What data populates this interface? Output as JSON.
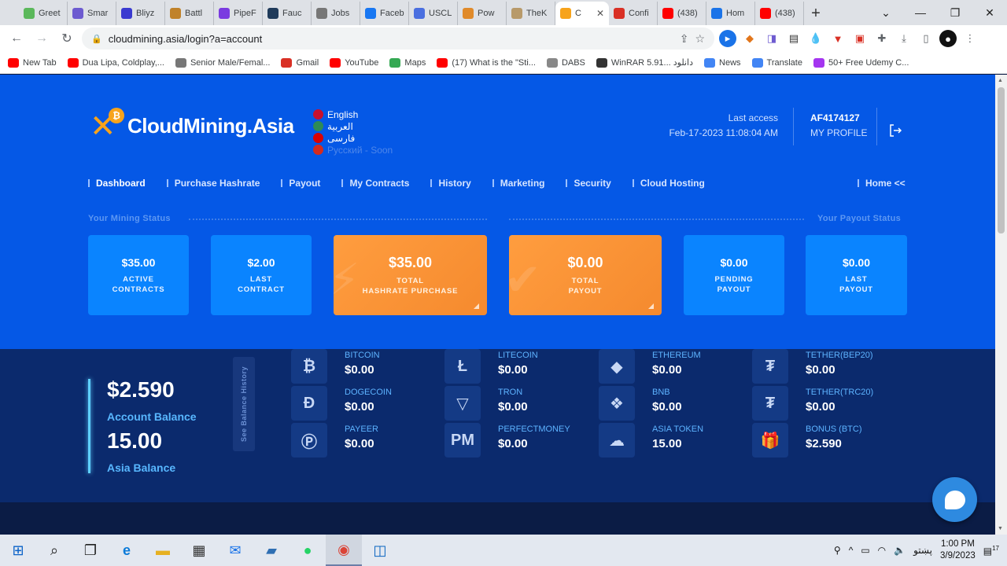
{
  "browser": {
    "tabs": [
      {
        "title": "Greet",
        "icon": "v-icon",
        "color": "#5bb85b"
      },
      {
        "title": "Smar",
        "icon": "shield-icon",
        "color": "#6d5bd0"
      },
      {
        "title": "Bliyz",
        "icon": "grid-icon",
        "color": "#3a3ad0"
      },
      {
        "title": "Battl",
        "icon": "cross-swords-icon",
        "color": "#c0822a"
      },
      {
        "title": "PipeF",
        "icon": "pipe-icon",
        "color": "#7a3be0"
      },
      {
        "title": "Fauc",
        "icon": "f-icon",
        "color": "#1f3a5a"
      },
      {
        "title": "Jobs",
        "icon": "person-icon",
        "color": "#777777"
      },
      {
        "title": "Faceb",
        "icon": "facebook-icon",
        "color": "#1877f2"
      },
      {
        "title": "USCL",
        "icon": "shield-icon",
        "color": "#4a6fe0"
      },
      {
        "title": "Pow",
        "icon": "paw-icon",
        "color": "#e08a2a"
      },
      {
        "title": "TheK",
        "icon": "badge-icon",
        "color": "#b89a6a"
      },
      {
        "title": "C",
        "icon": "cloudmining-icon",
        "color": "#f7a31b",
        "active": true
      },
      {
        "title": "Confi",
        "icon": "gmail-icon",
        "color": "#d93025"
      },
      {
        "title": "(438)",
        "icon": "youtube-icon",
        "color": "#ff0000"
      },
      {
        "title": "Hom",
        "icon": "chain-icon",
        "color": "#1a73e8"
      },
      {
        "title": "(438)",
        "icon": "youtube-icon",
        "color": "#ff0000"
      }
    ],
    "url": "cloudmining.asia/login?a=account",
    "bookmarks": [
      {
        "label": "New Tab",
        "color": "#ff0000"
      },
      {
        "label": "Dua Lipa, Coldplay,...",
        "color": "#ff0000"
      },
      {
        "label": "Senior Male/Femal...",
        "color": "#777777"
      },
      {
        "label": "Gmail",
        "color": "#d93025"
      },
      {
        "label": "YouTube",
        "color": "#ff0000"
      },
      {
        "label": "Maps",
        "color": "#34a853"
      },
      {
        "label": "(17) What is the \"Sti...",
        "color": "#ff0000"
      },
      {
        "label": "DABS",
        "color": "#888888"
      },
      {
        "label": "WinRAR 5.91... دانلود",
        "color": "#333333"
      },
      {
        "label": "News",
        "color": "#4285f4"
      },
      {
        "label": "Translate",
        "color": "#4285f4"
      },
      {
        "label": "50+ Free Udemy C...",
        "color": "#a435f0"
      }
    ]
  },
  "site": {
    "logo_text": "CloudMining.Asia",
    "languages": [
      {
        "label": "English",
        "flag": "#c8102e"
      },
      {
        "label": "العربية",
        "flag": "#2e8b57"
      },
      {
        "label": "فارسی",
        "flag": "#da0000"
      },
      {
        "label": "Русский - Soon",
        "flag": "#d52b1e",
        "muted": true
      }
    ],
    "last_access_label": "Last access",
    "last_access_time": "Feb-17-2023 11:08:04 AM",
    "account_id": "AF4174127",
    "my_profile": "MY PROFILE",
    "nav": [
      "Dashboard",
      "Purchase Hashrate",
      "Payout",
      "My Contracts",
      "History",
      "Marketing",
      "Security",
      "Cloud Hosting"
    ],
    "home_link": "Home <<",
    "mining_status_label": "Your Mining Status",
    "payout_status_label": "Your Payout Status",
    "cards": [
      {
        "value": "$35.00",
        "label1": "ACTIVE",
        "label2": "CONTRACTS"
      },
      {
        "value": "$2.00",
        "label1": "LAST",
        "label2": "CONTRACT"
      },
      {
        "value": "$35.00",
        "label1": "TOTAL",
        "label2": "HASHRATE PURCHASE"
      },
      {
        "value": "$0.00",
        "label1": "TOTAL",
        "label2": "PAYOUT"
      },
      {
        "value": "$0.00",
        "label1": "PENDING",
        "label2": "PAYOUT"
      },
      {
        "value": "$0.00",
        "label1": "LAST",
        "label2": "PAYOUT"
      }
    ],
    "account_balance": "$2.590",
    "account_balance_label": "Account Balance",
    "asia_balance": "15.00",
    "asia_balance_label": "Asia Balance",
    "balance_history": "See Balance History",
    "coins": [
      {
        "name": "BITCOIN",
        "value": "$0.00",
        "icon": "bitcoin-icon",
        "glyph": "₿"
      },
      {
        "name": "LITECOIN",
        "value": "$0.00",
        "icon": "litecoin-icon",
        "glyph": "Ł"
      },
      {
        "name": "ETHEREUM",
        "value": "$0.00",
        "icon": "ethereum-icon",
        "glyph": "◆"
      },
      {
        "name": "TETHER(BEP20)",
        "value": "$0.00",
        "icon": "tether-icon",
        "glyph": "₮"
      },
      {
        "name": "DOGECOIN",
        "value": "$0.00",
        "icon": "dogecoin-icon",
        "glyph": "Đ"
      },
      {
        "name": "TRON",
        "value": "$0.00",
        "icon": "tron-icon",
        "glyph": "▽"
      },
      {
        "name": "BNB",
        "value": "$0.00",
        "icon": "bnb-icon",
        "glyph": "❖"
      },
      {
        "name": "TETHER(TRC20)",
        "value": "$0.00",
        "icon": "tether-icon",
        "glyph": "₮"
      },
      {
        "name": "PAYEER",
        "value": "$0.00",
        "icon": "payeer-icon",
        "glyph": "Ⓟ"
      },
      {
        "name": "PERFECTMONEY",
        "value": "$0.00",
        "icon": "perfectmoney-icon",
        "glyph": "PM"
      },
      {
        "name": "ASIA TOKEN",
        "value": "15.00",
        "icon": "cloud-icon",
        "glyph": "☁"
      },
      {
        "name": "BONUS (BTC)",
        "value": "$2.590",
        "icon": "gift-icon",
        "glyph": "🎁"
      }
    ]
  },
  "taskbar": {
    "lang": "پښتو",
    "time": "1:00 PM",
    "date": "3/9/2023",
    "notifications": "17"
  }
}
